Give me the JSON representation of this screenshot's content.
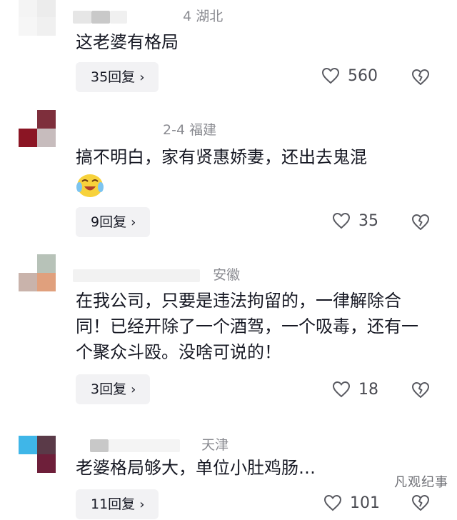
{
  "comments": [
    {
      "location": "4 湖北",
      "text": "这老婆有格局",
      "reply_label": "35回复",
      "likes": "560"
    },
    {
      "location": "2-4 福建",
      "text": "搞不明白，家有贤惠娇妻，还出去鬼混",
      "emoji": "crying-laughing-emoji",
      "reply_label": "9回复",
      "likes": "35"
    },
    {
      "location": "安徽",
      "text": "在我公司，只要是违法拘留的，一律解除合同！已经开除了一个酒驾，一个吸毒，还有一个聚众斗殴。没啥可说的！",
      "reply_label": "3回复",
      "likes": "18"
    },
    {
      "location": "天津",
      "text": "老婆格局够大，单位小肚鸡肠…",
      "reply_label": "11回复",
      "likes": "101"
    }
  ],
  "icons": {
    "like": "heart-outline-icon",
    "dislike": "broken-heart-icon",
    "chevron": "chevron-right-icon"
  },
  "watermark": "凡观纪事",
  "chevron_glyph": "›"
}
